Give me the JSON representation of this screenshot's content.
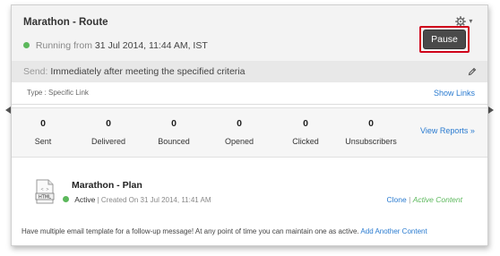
{
  "route": {
    "title": "Marathon - Route",
    "status_prefix": "Running from",
    "status_date": "31 Jul 2014, 11:44 AM, IST",
    "pause_label": "Pause",
    "settings_caret": "▾"
  },
  "send": {
    "label": "Send:",
    "value": "Immediately after  meeting the specified criteria"
  },
  "type_row": {
    "label": "Type : Specific Link",
    "show_links": "Show Links"
  },
  "stats": [
    {
      "value": "0",
      "label": "Sent"
    },
    {
      "value": "0",
      "label": "Delivered"
    },
    {
      "value": "0",
      "label": "Bounced"
    },
    {
      "value": "0",
      "label": "Opened"
    },
    {
      "value": "0",
      "label": "Clicked"
    },
    {
      "value": "0",
      "label": "Unsubscribers"
    }
  ],
  "view_reports": "View Reports »",
  "plan": {
    "icon_text": "HTML",
    "title": "Marathon - Plan",
    "status": "Active",
    "created": "| Created On 31 Jul 2014, 11:41 AM",
    "clone": "Clone",
    "separator": "|",
    "active_content": "Active Content"
  },
  "footer": {
    "text": "Have multiple email template for a follow-up message! At any point of time you can maintain one as active.",
    "link": "Add Another Content"
  },
  "colors": {
    "accent_link": "#2a7bd0",
    "status_green": "#5cb85c",
    "highlight_red": "#d0021b",
    "pause_button": "#4a4a4a"
  }
}
